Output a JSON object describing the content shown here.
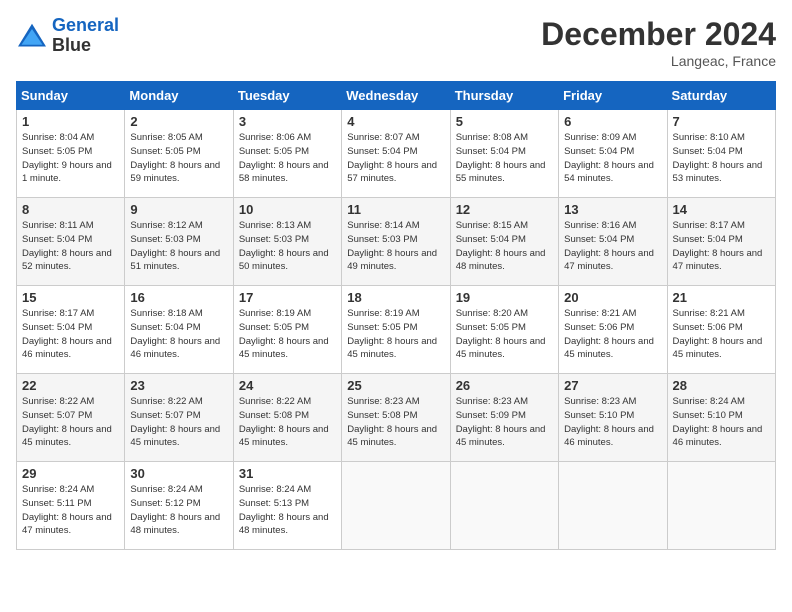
{
  "header": {
    "logo_line1": "General",
    "logo_line2": "Blue",
    "month": "December 2024",
    "location": "Langeac, France"
  },
  "weekdays": [
    "Sunday",
    "Monday",
    "Tuesday",
    "Wednesday",
    "Thursday",
    "Friday",
    "Saturday"
  ],
  "weeks": [
    [
      {
        "day": 1,
        "sunrise": "8:04 AM",
        "sunset": "5:05 PM",
        "daylight": "9 hours and 1 minute."
      },
      {
        "day": 2,
        "sunrise": "8:05 AM",
        "sunset": "5:05 PM",
        "daylight": "8 hours and 59 minutes."
      },
      {
        "day": 3,
        "sunrise": "8:06 AM",
        "sunset": "5:05 PM",
        "daylight": "8 hours and 58 minutes."
      },
      {
        "day": 4,
        "sunrise": "8:07 AM",
        "sunset": "5:04 PM",
        "daylight": "8 hours and 57 minutes."
      },
      {
        "day": 5,
        "sunrise": "8:08 AM",
        "sunset": "5:04 PM",
        "daylight": "8 hours and 55 minutes."
      },
      {
        "day": 6,
        "sunrise": "8:09 AM",
        "sunset": "5:04 PM",
        "daylight": "8 hours and 54 minutes."
      },
      {
        "day": 7,
        "sunrise": "8:10 AM",
        "sunset": "5:04 PM",
        "daylight": "8 hours and 53 minutes."
      }
    ],
    [
      {
        "day": 8,
        "sunrise": "8:11 AM",
        "sunset": "5:04 PM",
        "daylight": "8 hours and 52 minutes."
      },
      {
        "day": 9,
        "sunrise": "8:12 AM",
        "sunset": "5:03 PM",
        "daylight": "8 hours and 51 minutes."
      },
      {
        "day": 10,
        "sunrise": "8:13 AM",
        "sunset": "5:03 PM",
        "daylight": "8 hours and 50 minutes."
      },
      {
        "day": 11,
        "sunrise": "8:14 AM",
        "sunset": "5:03 PM",
        "daylight": "8 hours and 49 minutes."
      },
      {
        "day": 12,
        "sunrise": "8:15 AM",
        "sunset": "5:04 PM",
        "daylight": "8 hours and 48 minutes."
      },
      {
        "day": 13,
        "sunrise": "8:16 AM",
        "sunset": "5:04 PM",
        "daylight": "8 hours and 47 minutes."
      },
      {
        "day": 14,
        "sunrise": "8:17 AM",
        "sunset": "5:04 PM",
        "daylight": "8 hours and 47 minutes."
      }
    ],
    [
      {
        "day": 15,
        "sunrise": "8:17 AM",
        "sunset": "5:04 PM",
        "daylight": "8 hours and 46 minutes."
      },
      {
        "day": 16,
        "sunrise": "8:18 AM",
        "sunset": "5:04 PM",
        "daylight": "8 hours and 46 minutes."
      },
      {
        "day": 17,
        "sunrise": "8:19 AM",
        "sunset": "5:05 PM",
        "daylight": "8 hours and 45 minutes."
      },
      {
        "day": 18,
        "sunrise": "8:19 AM",
        "sunset": "5:05 PM",
        "daylight": "8 hours and 45 minutes."
      },
      {
        "day": 19,
        "sunrise": "8:20 AM",
        "sunset": "5:05 PM",
        "daylight": "8 hours and 45 minutes."
      },
      {
        "day": 20,
        "sunrise": "8:21 AM",
        "sunset": "5:06 PM",
        "daylight": "8 hours and 45 minutes."
      },
      {
        "day": 21,
        "sunrise": "8:21 AM",
        "sunset": "5:06 PM",
        "daylight": "8 hours and 45 minutes."
      }
    ],
    [
      {
        "day": 22,
        "sunrise": "8:22 AM",
        "sunset": "5:07 PM",
        "daylight": "8 hours and 45 minutes."
      },
      {
        "day": 23,
        "sunrise": "8:22 AM",
        "sunset": "5:07 PM",
        "daylight": "8 hours and 45 minutes."
      },
      {
        "day": 24,
        "sunrise": "8:22 AM",
        "sunset": "5:08 PM",
        "daylight": "8 hours and 45 minutes."
      },
      {
        "day": 25,
        "sunrise": "8:23 AM",
        "sunset": "5:08 PM",
        "daylight": "8 hours and 45 minutes."
      },
      {
        "day": 26,
        "sunrise": "8:23 AM",
        "sunset": "5:09 PM",
        "daylight": "8 hours and 45 minutes."
      },
      {
        "day": 27,
        "sunrise": "8:23 AM",
        "sunset": "5:10 PM",
        "daylight": "8 hours and 46 minutes."
      },
      {
        "day": 28,
        "sunrise": "8:24 AM",
        "sunset": "5:10 PM",
        "daylight": "8 hours and 46 minutes."
      }
    ],
    [
      {
        "day": 29,
        "sunrise": "8:24 AM",
        "sunset": "5:11 PM",
        "daylight": "8 hours and 47 minutes."
      },
      {
        "day": 30,
        "sunrise": "8:24 AM",
        "sunset": "5:12 PM",
        "daylight": "8 hours and 48 minutes."
      },
      {
        "day": 31,
        "sunrise": "8:24 AM",
        "sunset": "5:13 PM",
        "daylight": "8 hours and 48 minutes."
      },
      null,
      null,
      null,
      null
    ]
  ]
}
